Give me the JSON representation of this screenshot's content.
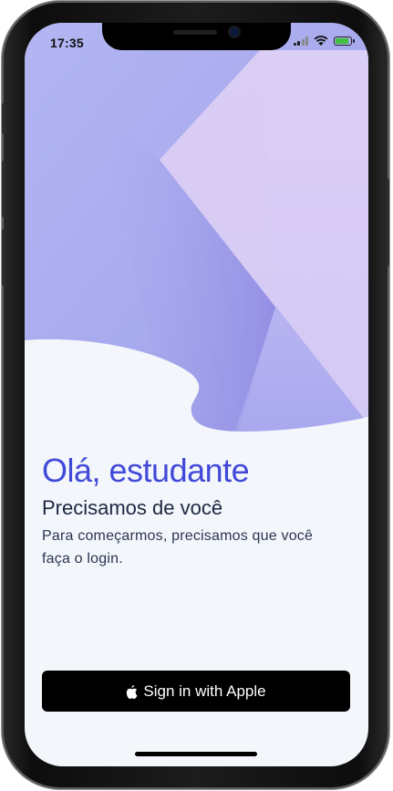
{
  "status_bar": {
    "time": "17:35"
  },
  "welcome": {
    "title": "Olá, estudante",
    "subtitle": "Precisamos de você",
    "description": "Para começarmos, precisamos que você faça o login."
  },
  "sign_in": {
    "label": "Sign in with Apple"
  },
  "colors": {
    "accent": "#4149d8",
    "hero_light": "#d8cdf5",
    "hero_main": "#adadf0",
    "background": "#f3f6fb",
    "button": "#000000"
  },
  "icons": [
    "signal-icon",
    "wifi-icon",
    "battery-icon",
    "apple-logo-icon"
  ]
}
